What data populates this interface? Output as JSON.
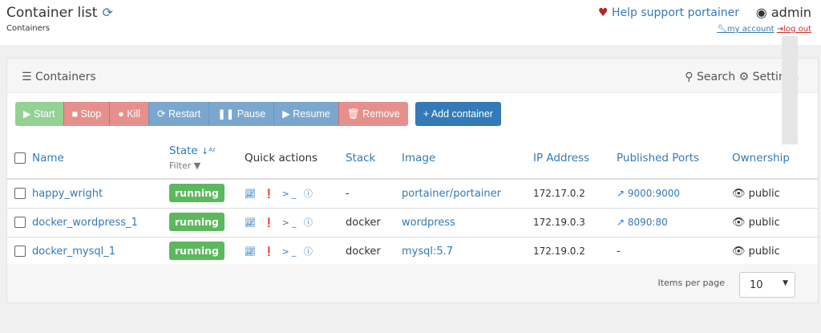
{
  "header": {
    "title": "Container list",
    "breadcrumb": "Containers",
    "help": "Help support portainer",
    "user": "admin",
    "my_account": "my account",
    "logout": "log out"
  },
  "panel": {
    "title": "Containers",
    "search": "Search",
    "settings": "Settings"
  },
  "actions": {
    "start": "Start",
    "stop": "Stop",
    "kill": "Kill",
    "restart": "Restart",
    "pause": "Pause",
    "resume": "Resume",
    "remove": "Remove",
    "add": "Add container"
  },
  "table": {
    "columns": {
      "name": "Name",
      "state": "State",
      "filter": "Filter",
      "quick": "Quick actions",
      "stack": "Stack",
      "image": "Image",
      "ip": "IP Address",
      "ports": "Published Ports",
      "ownership": "Ownership"
    },
    "rows": [
      {
        "name": "happy_wright",
        "state": "running",
        "stack": "-",
        "image": "portainer/portainer",
        "ip": "172.17.0.2",
        "ports": "9000:9000",
        "ownership": "public"
      },
      {
        "name": "docker_wordpress_1",
        "state": "running",
        "stack": "docker",
        "image": "wordpress",
        "ip": "172.19.0.3",
        "ports": "8090:80",
        "ownership": "public"
      },
      {
        "name": "docker_mysql_1",
        "state": "running",
        "stack": "docker",
        "image": "mysql:5.7",
        "ip": "172.19.0.2",
        "ports": "-",
        "ownership": "public"
      }
    ]
  },
  "footer": {
    "items_per_page": "Items per page",
    "page_size": "10"
  }
}
